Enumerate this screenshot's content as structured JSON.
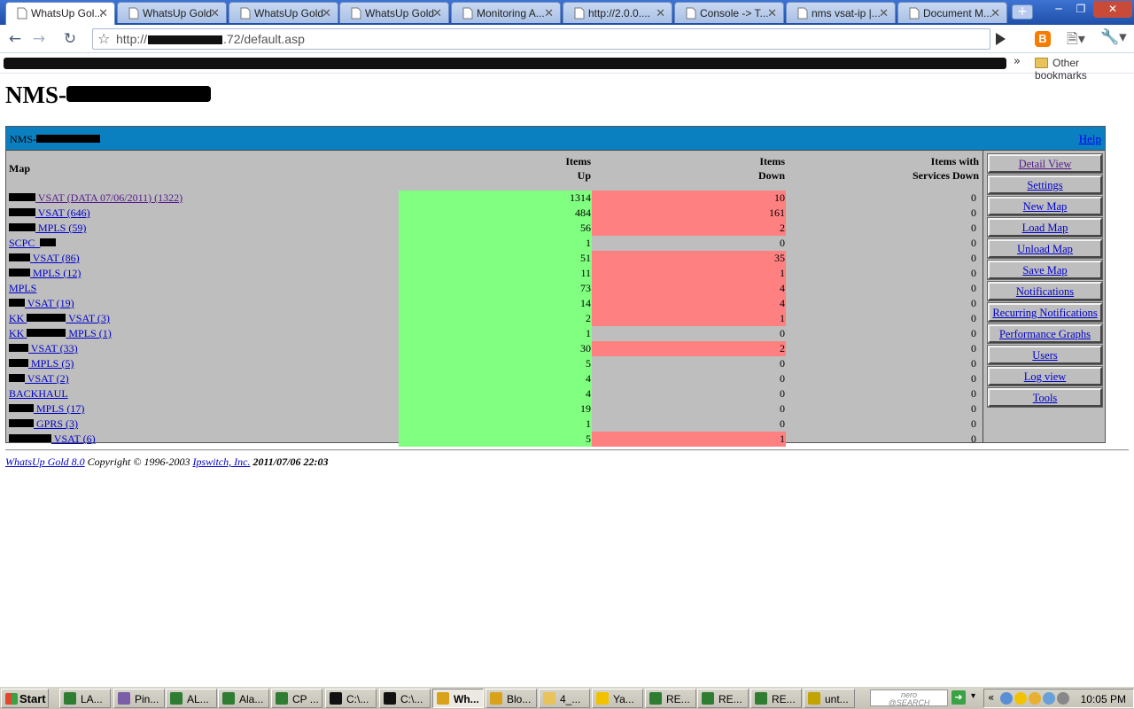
{
  "browser": {
    "tabs": [
      {
        "label": "WhatsUp Gol...",
        "active": true
      },
      {
        "label": "WhatsUp Gold",
        "active": false
      },
      {
        "label": "WhatsUp Gold",
        "active": false
      },
      {
        "label": "WhatsUp Gold",
        "active": false
      },
      {
        "label": "Monitoring A...",
        "active": false
      },
      {
        "label": "http://2.0.0....",
        "active": false
      },
      {
        "label": "Console -> T...",
        "active": false
      },
      {
        "label": "nms vsat-ip |...",
        "active": false
      },
      {
        "label": "Document M...",
        "active": false
      }
    ],
    "url_prefix": "http://",
    "url_suffix": ".72/default.asp",
    "other_bookmarks": "Other bookmarks"
  },
  "page": {
    "title_prefix": "NMS-",
    "panel_name_prefix": "NMS-",
    "help": "Help",
    "columns": {
      "map": "Map",
      "items_up_1": "Items",
      "items_up_2": "Up",
      "items_down_1": "Items",
      "items_down_2": "Down",
      "svc_1": "Items with",
      "svc_2": "Services Down"
    },
    "rows": [
      {
        "name": "VSAT (DATA 07/06/2011) (1322)",
        "redact": 30,
        "up": "1314",
        "down": "10",
        "svc": "0",
        "visited": true
      },
      {
        "name": "VSAT (646)",
        "redact": 30,
        "up": "484",
        "down": "161",
        "svc": "0"
      },
      {
        "name": "MPLS (59)",
        "redact": 30,
        "up": "56",
        "down": "2",
        "svc": "0"
      },
      {
        "name": "SCPC_",
        "redact": 0,
        "tail_redact": 18,
        "up": "1",
        "down": "0",
        "svc": "0"
      },
      {
        "name": "VSAT (86)",
        "redact": 24,
        "up": "51",
        "down": "35",
        "svc": "0"
      },
      {
        "name": "MPLS (12)",
        "redact": 24,
        "up": "11",
        "down": "1",
        "svc": "0"
      },
      {
        "name": "MPLS",
        "redact": 0,
        "up": "73",
        "down": "4",
        "svc": "0"
      },
      {
        "name": "VSAT (19)",
        "redact": 18,
        "up": "14",
        "down": "4",
        "svc": "0"
      },
      {
        "name": "KK",
        "redact": 0,
        "mid_redact": 44,
        "name2": "VSAT (3)",
        "up": "2",
        "down": "1",
        "svc": "0"
      },
      {
        "name": "KK",
        "redact": 0,
        "mid_redact": 44,
        "name2": "MPLS (1)",
        "up": "1",
        "down": "0",
        "svc": "0"
      },
      {
        "name": "VSAT (33)",
        "redact": 22,
        "up": "30",
        "down": "2",
        "svc": "0"
      },
      {
        "name": "MPLS (5)",
        "redact": 22,
        "up": "5",
        "down": "0",
        "svc": "0"
      },
      {
        "name": "VSAT (2)",
        "redact": 18,
        "up": "4",
        "down": "0",
        "svc": "0"
      },
      {
        "name": "BACKHAUL",
        "redact": 0,
        "up": "4",
        "down": "0",
        "svc": "0"
      },
      {
        "name": "MPLS (17)",
        "redact": 28,
        "up": "19",
        "down": "0",
        "svc": "0"
      },
      {
        "name": "GPRS (3)",
        "redact": 28,
        "up": "1",
        "down": "0",
        "svc": "0"
      },
      {
        "name": "VSAT (6)",
        "redact": 48,
        "up": "5",
        "down": "1",
        "svc": "0"
      }
    ],
    "side_buttons": [
      {
        "label": "Detail View",
        "visited": true
      },
      {
        "label": "Settings"
      },
      {
        "label": "New Map"
      },
      {
        "label": "Load Map"
      },
      {
        "label": "Unload Map"
      },
      {
        "label": "Save Map"
      },
      {
        "label": "Notifications"
      },
      {
        "label": "Recurring Notifications"
      },
      {
        "label": "Performance Graphs"
      },
      {
        "label": "Users"
      },
      {
        "label": "Log view"
      },
      {
        "label": "Tools"
      }
    ],
    "footer": {
      "product": "WhatsUp Gold 8.0",
      "copyright": " Copyright © 1996-2003 ",
      "company": "Ipswitch, Inc.",
      "datetime": " 2011/07/06 22:03"
    }
  },
  "taskbar": {
    "start": "Start",
    "tasks": [
      {
        "label": "LA...",
        "color": "#2e7d32"
      },
      {
        "label": "Pin...",
        "color": "#7b5ea7"
      },
      {
        "label": "AL...",
        "color": "#2e7d32"
      },
      {
        "label": "Ala...",
        "color": "#2e7d32"
      },
      {
        "label": "CP ...",
        "color": "#2e7d32"
      },
      {
        "label": "C:\\...",
        "color": "#111111"
      },
      {
        "label": "C:\\...",
        "color": "#111111"
      },
      {
        "label": "Wh...",
        "color": "#d9a21b",
        "active": true
      },
      {
        "label": "Blo...",
        "color": "#d9a21b"
      },
      {
        "label": "4_...",
        "color": "#e8c25a"
      },
      {
        "label": "Ya...",
        "color": "#f2c200"
      },
      {
        "label": "RE...",
        "color": "#2e7d32"
      },
      {
        "label": "RE...",
        "color": "#2e7d32"
      },
      {
        "label": "RE...",
        "color": "#2e7d32"
      },
      {
        "label": "unt...",
        "color": "#c2a400"
      }
    ],
    "search_box": "nero\n@SEARCH",
    "clock": "10:05 PM"
  }
}
